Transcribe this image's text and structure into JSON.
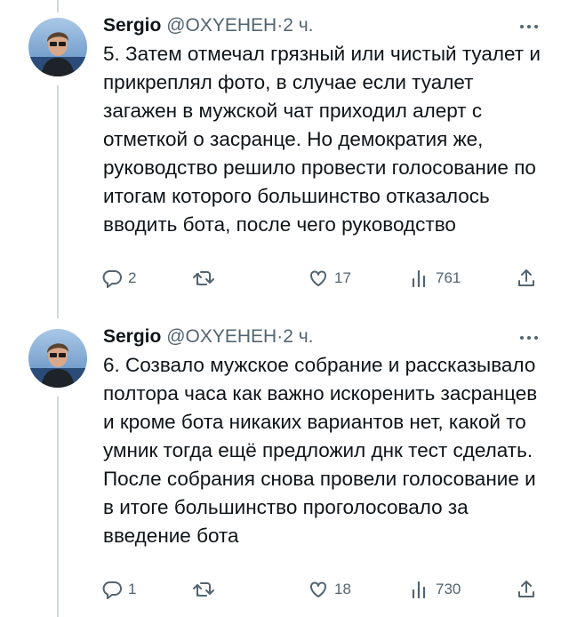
{
  "tweets": [
    {
      "author": {
        "name": "Sergio",
        "handle": "@OXYEHEH",
        "sep": "·",
        "time": "2 ч."
      },
      "text": "5. Затем отмечал грязный или чистый туалет и прикреплял фото, в случае если туалет загажен в мужской чат приходил алерт с отметкой о засранце. Но демократия же, руководство решило провести голосование по итогам которого большинство отказалось вводить бота, после чего руководство",
      "actions": {
        "replies": "2",
        "likes": "17",
        "views": "761"
      }
    },
    {
      "author": {
        "name": "Sergio",
        "handle": "@OXYEHEH",
        "sep": "·",
        "time": "2 ч."
      },
      "text": "6. Созвало мужское собрание и рассказывало полтора часа как важно искоренить засранцев и кроме бота никаких вариантов нет, какой то умник тогда ещё предложил днк тест сделать. После собрания снова провели голосование и в итоге большинство проголосовало за введение бота",
      "actions": {
        "replies": "1",
        "likes": "18",
        "views": "730"
      }
    }
  ],
  "colors": {
    "text": "#0f1419",
    "muted": "#536471",
    "thread_line": "#cfd9de"
  },
  "icons": [
    "reply-icon",
    "retweet-icon",
    "like-icon",
    "views-icon",
    "share-icon",
    "more-icon"
  ]
}
